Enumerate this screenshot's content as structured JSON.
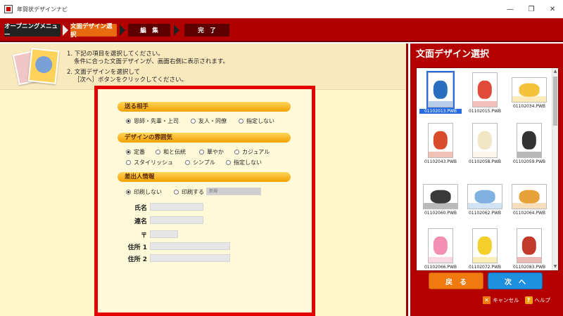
{
  "window": {
    "title": "年賀状デザインナビ"
  },
  "steps": [
    {
      "label": "オープニングメニュー"
    },
    {
      "label": "文面デザイン選択"
    },
    {
      "label": "編　集"
    },
    {
      "label": "完　了"
    }
  ],
  "instructions": [
    "1. 下記の項目を選択してください。",
    "条件に合った文面デザインが、画面右側に表示されます。",
    "2. 文面デザインを選択して",
    "［次へ］ボタンをクリックしてください。"
  ],
  "form": {
    "recipient": {
      "heading": "送る相手",
      "options": [
        "恩師・先輩・上司",
        "友人・同僚",
        "指定しない"
      ],
      "selected": "恩師・先輩・上司"
    },
    "mood": {
      "heading": "デザインの雰囲気",
      "options": [
        "定番",
        "和と伝統",
        "華やか",
        "カジュアル",
        "スタイリッシュ",
        "シンプル",
        "指定しない"
      ],
      "selected": "定番"
    },
    "sender": {
      "heading": "差出人情報",
      "options": [
        "印刷しない",
        "印刷する"
      ],
      "selected": "印刷しない",
      "print_select_value": "新規",
      "fields": {
        "name": {
          "label": "氏名",
          "value": ""
        },
        "joint_name": {
          "label": "連名",
          "value": ""
        },
        "postal": {
          "label": "〒",
          "value": ""
        },
        "address1": {
          "label": "住所 1",
          "value": ""
        },
        "address2": {
          "label": "住所 2",
          "value": ""
        }
      }
    }
  },
  "right_panel": {
    "title": "文面デザイン選択",
    "thumbnails": [
      {
        "caption": "01102013.PWB",
        "orientation": "portrait",
        "color": "#2a6fbf",
        "selected": true
      },
      {
        "caption": "01102015.PWB",
        "orientation": "portrait",
        "color": "#e04a3a",
        "selected": false
      },
      {
        "caption": "01102034.PWB",
        "orientation": "landscape",
        "color": "#f3c23a",
        "selected": false
      },
      {
        "caption": "01102043.PWB",
        "orientation": "portrait",
        "color": "#d84c2c",
        "selected": false
      },
      {
        "caption": "01102058.PWB",
        "orientation": "portrait",
        "color": "#f1e6c6",
        "selected": false
      },
      {
        "caption": "01102059.PWB",
        "orientation": "portrait",
        "color": "#333333",
        "selected": false
      },
      {
        "caption": "01102060.PWB",
        "orientation": "landscape",
        "color": "#3a3a3a",
        "selected": false
      },
      {
        "caption": "01102062.PWB",
        "orientation": "landscape",
        "color": "#7fb2e0",
        "selected": false
      },
      {
        "caption": "01102064.PWB",
        "orientation": "landscape",
        "color": "#e8a03a",
        "selected": false
      },
      {
        "caption": "01102066.PWB",
        "orientation": "portrait",
        "color": "#f28fb2",
        "selected": false
      },
      {
        "caption": "01102072.PWB",
        "orientation": "portrait",
        "color": "#f2cf2a",
        "selected": false
      },
      {
        "caption": "01102083.PWB",
        "orientation": "portrait",
        "color": "#c0392b",
        "selected": false
      }
    ],
    "back_label": "戻　る",
    "next_label": "次　へ",
    "cancel_label": "キャンセル",
    "help_label": "ヘルプ"
  },
  "colors": {
    "primary_red": "#b40000",
    "highlight_red": "#e20000",
    "orange": "#f07a10",
    "blue": "#1f8fe0"
  }
}
